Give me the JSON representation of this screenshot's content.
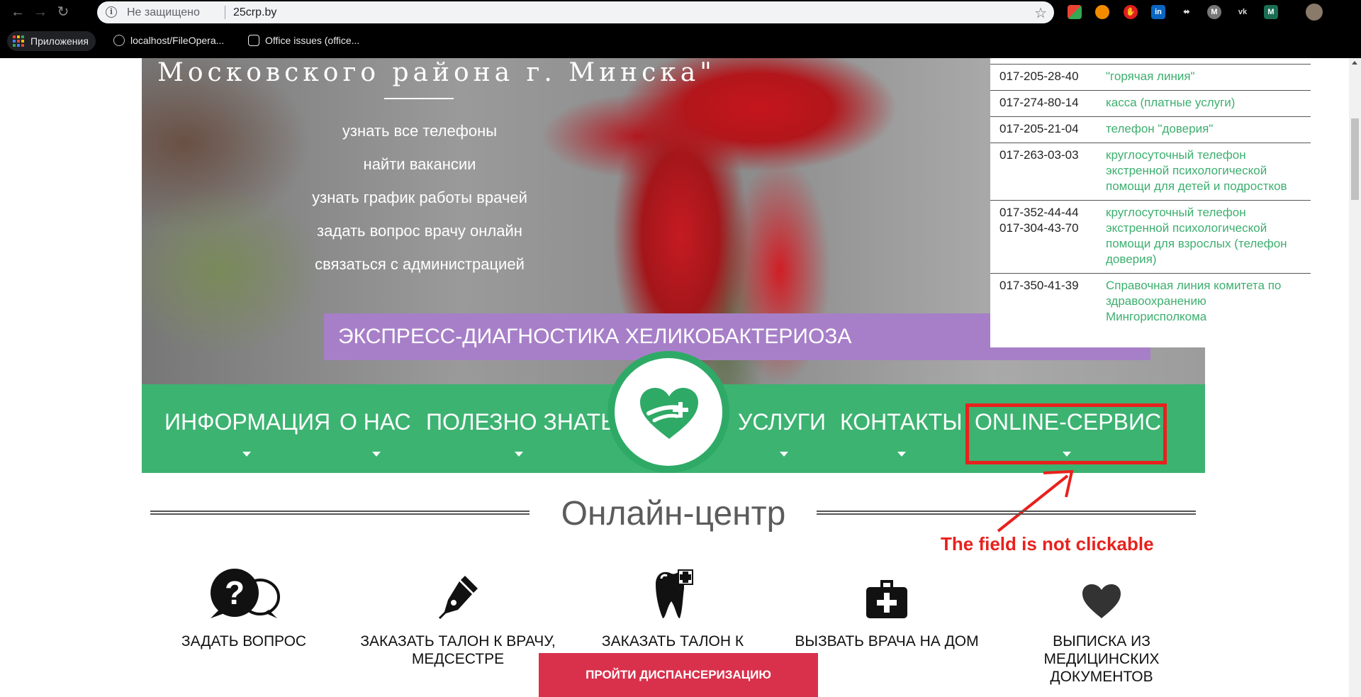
{
  "browser": {
    "insecure_label": "Не защищено",
    "url": "25crp.by",
    "bookmarks": [
      {
        "label": "Приложения"
      },
      {
        "label": "localhost/FileOpera..."
      },
      {
        "label": "Office issues (office..."
      }
    ]
  },
  "hero": {
    "title": "Московского района г. Минска\"",
    "links": [
      "узнать все телефоны",
      "найти вакансии",
      "узнать график работы врачей",
      "задать вопрос врачу онлайн",
      "связаться с администрацией"
    ],
    "promo": "ЭКСПРЕСС-ДИАГНОСТИКА ХЕЛИКОБАКТЕРИОЗА"
  },
  "phones": [
    {
      "numbers": [
        "017-205-28-40"
      ],
      "desc": "\"горячая линия\""
    },
    {
      "numbers": [
        "017-274-80-14"
      ],
      "desc": "касса (платные услуги)"
    },
    {
      "numbers": [
        "017-205-21-04"
      ],
      "desc": "телефон \"доверия\""
    },
    {
      "numbers": [
        "017-263-03-03"
      ],
      "desc": "круглосуточный телефон экстренной психологической помощи для детей и подростков"
    },
    {
      "numbers": [
        "017-352-44-44",
        "017-304-43-70"
      ],
      "desc": "круглосуточный телефон экстренной психологической помощи для взрослых (телефон доверия)"
    },
    {
      "numbers": [
        "017-350-41-39"
      ],
      "desc": "Справочная линия комитета по здравоохранению Мингорисполкома"
    }
  ],
  "nav": {
    "items": [
      "ИНФОРМАЦИЯ",
      "О НАС",
      "ПОЛЕЗНО ЗНАТЬ",
      "УСЛУГИ",
      "КОНТАКТЫ",
      "ONLINE-СЕРВИС"
    ]
  },
  "annotation": {
    "text": "The field is not clickable",
    "color": "#e8211d"
  },
  "online_center": {
    "title": "Онлайн-центр",
    "services": [
      {
        "label": "ЗАДАТЬ ВОПРОС",
        "icon": "question-bubble-icon"
      },
      {
        "label": "ЗАКАЗАТЬ ТАЛОН К ВРАЧУ, МЕДСЕСТРЕ",
        "icon": "pen-icon"
      },
      {
        "label": "ЗАКАЗАТЬ ТАЛОН К СТОМАТОЛОГУ",
        "icon": "tooth-icon"
      },
      {
        "label": "ВЫЗВАТЬ ВРАЧА НА ДОМ",
        "icon": "medkit-icon"
      },
      {
        "label": "ВЫПИСКА ИЗ МЕДИЦИНСКИХ ДОКУМЕНТОВ",
        "icon": "heart-icon"
      }
    ],
    "cta": "ПРОЙТИ ДИСПАНСЕРИЗАЦИЮ"
  },
  "colors": {
    "brand_green": "#3cb371",
    "promo_purple": "#a77fc8",
    "cta_red": "#d9314c",
    "link_green": "#3daf6f"
  }
}
